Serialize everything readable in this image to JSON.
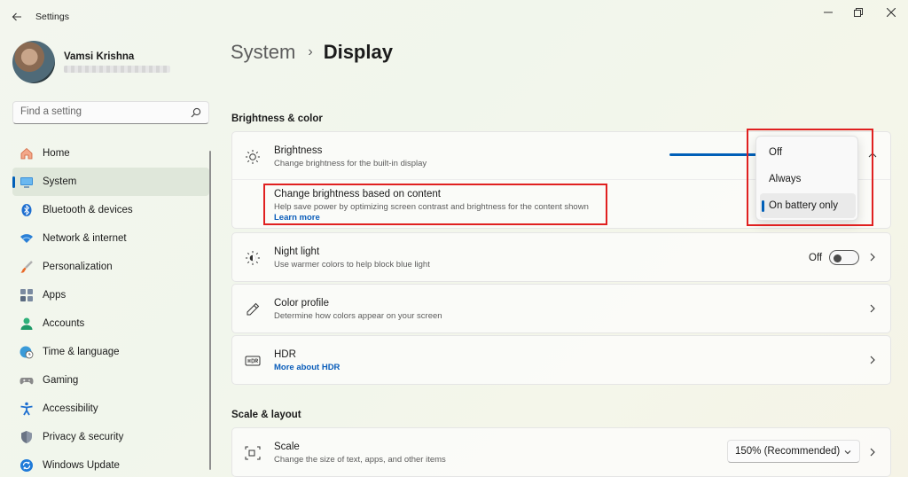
{
  "window": {
    "title": "Settings"
  },
  "user": {
    "name": "Vamsi Krishna"
  },
  "search": {
    "placeholder": "Find a setting"
  },
  "sidebar": {
    "items": [
      {
        "label": "Home",
        "icon": "home-icon"
      },
      {
        "label": "System",
        "icon": "monitor-icon",
        "active": true
      },
      {
        "label": "Bluetooth & devices",
        "icon": "bluetooth-icon"
      },
      {
        "label": "Network & internet",
        "icon": "wifi-icon"
      },
      {
        "label": "Personalization",
        "icon": "brush-icon"
      },
      {
        "label": "Apps",
        "icon": "apps-icon"
      },
      {
        "label": "Accounts",
        "icon": "person-icon"
      },
      {
        "label": "Time & language",
        "icon": "globe-clock-icon"
      },
      {
        "label": "Gaming",
        "icon": "gamepad-icon"
      },
      {
        "label": "Accessibility",
        "icon": "accessibility-icon"
      },
      {
        "label": "Privacy & security",
        "icon": "shield-icon"
      },
      {
        "label": "Windows Update",
        "icon": "update-icon"
      }
    ]
  },
  "breadcrumb": {
    "parent": "System",
    "separator": "›",
    "current": "Display"
  },
  "sections": {
    "brightness_color": "Brightness & color",
    "scale_layout": "Scale & layout"
  },
  "brightness": {
    "title": "Brightness",
    "subtitle": "Change brightness for the built-in display",
    "content_title": "Change brightness based on content",
    "content_subtitle": "Help save power by optimizing screen contrast and brightness for the content shown",
    "learn_more": "Learn more"
  },
  "dropdown": {
    "options": [
      "Off",
      "Always",
      "On battery only"
    ],
    "selected": "On battery only"
  },
  "night_light": {
    "title": "Night light",
    "subtitle": "Use warmer colors to help block blue light",
    "state": "Off"
  },
  "color_profile": {
    "title": "Color profile",
    "subtitle": "Determine how colors appear on your screen"
  },
  "hdr": {
    "title": "HDR",
    "link": "More about HDR"
  },
  "scale": {
    "title": "Scale",
    "subtitle": "Change the size of text, apps, and other items",
    "value": "150% (Recommended)"
  },
  "colors": {
    "accent": "#005fb8",
    "highlight": "#e02020"
  }
}
